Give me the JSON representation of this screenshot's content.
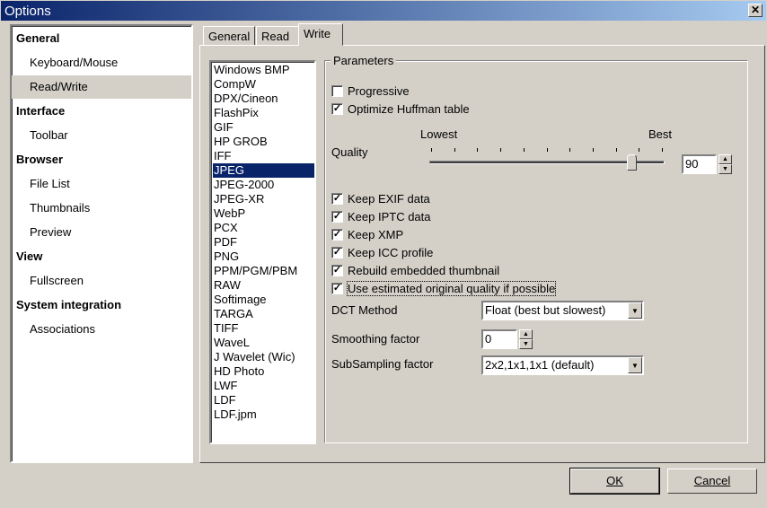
{
  "window": {
    "title": "Options",
    "close_label": "✕"
  },
  "nav": [
    {
      "label": "General",
      "type": "cat"
    },
    {
      "label": "Keyboard/Mouse",
      "type": "sub"
    },
    {
      "label": "Read/Write",
      "type": "sub",
      "selected": true
    },
    {
      "label": "Interface",
      "type": "cat"
    },
    {
      "label": "Toolbar",
      "type": "sub"
    },
    {
      "label": "Browser",
      "type": "cat"
    },
    {
      "label": "File List",
      "type": "sub"
    },
    {
      "label": "Thumbnails",
      "type": "sub"
    },
    {
      "label": "Preview",
      "type": "sub"
    },
    {
      "label": "View",
      "type": "cat"
    },
    {
      "label": "Fullscreen",
      "type": "sub"
    },
    {
      "label": "System integration",
      "type": "cat"
    },
    {
      "label": "Associations",
      "type": "sub"
    }
  ],
  "tabs": [
    {
      "label": "General"
    },
    {
      "label": "Read"
    },
    {
      "label": "Write",
      "active": true
    }
  ],
  "formats": [
    "Windows BMP",
    "CompW",
    "DPX/Cineon",
    "FlashPix",
    "GIF",
    "HP GROB",
    "IFF",
    "JPEG",
    "JPEG-2000",
    "JPEG-XR",
    "WebP",
    "PCX",
    "PDF",
    "PNG",
    "PPM/PGM/PBM",
    "RAW",
    "Softimage",
    "TARGA",
    "TIFF",
    "WaveL",
    "J Wavelet (Wic)",
    "HD Photo",
    "LWF",
    "LDF",
    "LDF.jpm"
  ],
  "selected_format": "JPEG",
  "params": {
    "group_label": "Parameters",
    "progressive": {
      "label": "Progressive",
      "checked": false
    },
    "huffman": {
      "label": "Optimize Huffman table",
      "checked": true
    },
    "quality": {
      "label": "Quality",
      "low_label": "Lowest",
      "high_label": "Best",
      "value": "90",
      "slider_fraction": 0.9
    },
    "checks": [
      {
        "label": "Keep EXIF data",
        "checked": true
      },
      {
        "label": "Keep IPTC data",
        "checked": true
      },
      {
        "label": "Keep XMP",
        "checked": true
      },
      {
        "label": "Keep ICC profile",
        "checked": true
      },
      {
        "label": "Rebuild embedded thumbnail",
        "checked": true
      },
      {
        "label": "Use estimated original quality if possible",
        "checked": true
      }
    ],
    "dct": {
      "label": "DCT Method",
      "value": "Float (best but slowest)"
    },
    "smoothing": {
      "label": "Smoothing factor",
      "value": "0"
    },
    "subsampling": {
      "label": "SubSampling factor",
      "value": "2x2,1x1,1x1 (default)"
    }
  },
  "buttons": {
    "ok": "OK",
    "cancel": "Cancel"
  }
}
